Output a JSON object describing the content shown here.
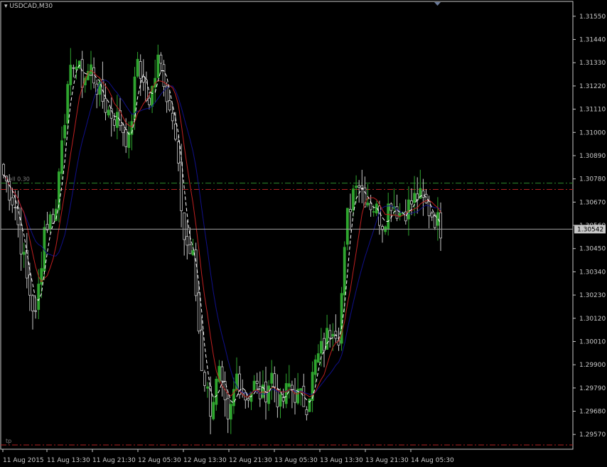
{
  "chart_data": {
    "type": "candlestick",
    "symbol_label": "USDCAD,M30",
    "current_price_label": "1.30542",
    "current_price": 1.30542,
    "ylim": [
      1.295,
      1.316
    ],
    "y_ticks": [
      "1.31550",
      "1.31440",
      "1.31330",
      "1.31220",
      "1.31110",
      "1.31000",
      "1.30890",
      "1.30780",
      "1.30670",
      "1.30560",
      "1.30450",
      "1.30340",
      "1.30230",
      "1.30120",
      "1.30010",
      "1.29900",
      "1.29790",
      "1.29680",
      "1.29570"
    ],
    "x_ticks": [
      "11 Aug 2015",
      "11 Aug 13:30",
      "11 Aug 21:30",
      "12 Aug 05:30",
      "12 Aug 13:30",
      "12 Aug 21:30",
      "13 Aug 05:30",
      "13 Aug 13:30",
      "13 Aug 21:30",
      "14 Aug 05:30"
    ],
    "levels": [
      {
        "name": "sell",
        "label": "sell 0.30",
        "price": 1.3076,
        "color": "#2e8b2e"
      },
      {
        "name": "sell_price",
        "label": "",
        "price": 1.3073,
        "color": "#b22222"
      },
      {
        "name": "tp",
        "label": "tp",
        "price": 1.2952,
        "color": "#b22222"
      }
    ],
    "colors": {
      "bull": "#2fa52f",
      "bear": "#c8c8c8",
      "ma_fast": "#ffffff",
      "ma_mid": "#c02020",
      "ma_slow": "#10108a",
      "axis": "#c8c8c8",
      "price_line": "#a0a0a0"
    },
    "close_anchors": [
      [
        0,
        1.308
      ],
      [
        4,
        1.3065
      ],
      [
        8,
        1.303
      ],
      [
        11,
        1.3012
      ],
      [
        14,
        1.3055
      ],
      [
        18,
        1.3063
      ],
      [
        20,
        1.31
      ],
      [
        24,
        1.3135
      ],
      [
        27,
        1.3125
      ],
      [
        30,
        1.313
      ],
      [
        33,
        1.3118
      ],
      [
        36,
        1.311
      ],
      [
        40,
        1.3105
      ],
      [
        43,
        1.3095
      ],
      [
        46,
        1.3135
      ],
      [
        50,
        1.311
      ],
      [
        53,
        1.314
      ],
      [
        56,
        1.312
      ],
      [
        59,
        1.3095
      ],
      [
        62,
        1.305
      ],
      [
        65,
        1.304
      ],
      [
        68,
        1.299
      ],
      [
        71,
        1.297
      ],
      [
        74,
        1.2985
      ],
      [
        77,
        1.296
      ],
      [
        80,
        1.2985
      ],
      [
        83,
        1.2975
      ],
      [
        86,
        1.298
      ],
      [
        89,
        1.2975
      ],
      [
        92,
        1.2985
      ],
      [
        95,
        1.297
      ],
      [
        98,
        1.298
      ],
      [
        101,
        1.2975
      ],
      [
        104,
        1.2972
      ],
      [
        107,
        1.299
      ],
      [
        110,
        1.3
      ],
      [
        113,
        1.301
      ],
      [
        115,
        1.3005
      ],
      [
        118,
        1.306
      ],
      [
        121,
        1.308
      ],
      [
        124,
        1.307
      ],
      [
        127,
        1.3065
      ],
      [
        130,
        1.3058
      ],
      [
        133,
        1.3068
      ],
      [
        136,
        1.3062
      ],
      [
        139,
        1.3065
      ],
      [
        142,
        1.307
      ],
      [
        145,
        1.3065
      ],
      [
        148,
        1.306
      ],
      [
        150,
        1.3055
      ]
    ]
  }
}
